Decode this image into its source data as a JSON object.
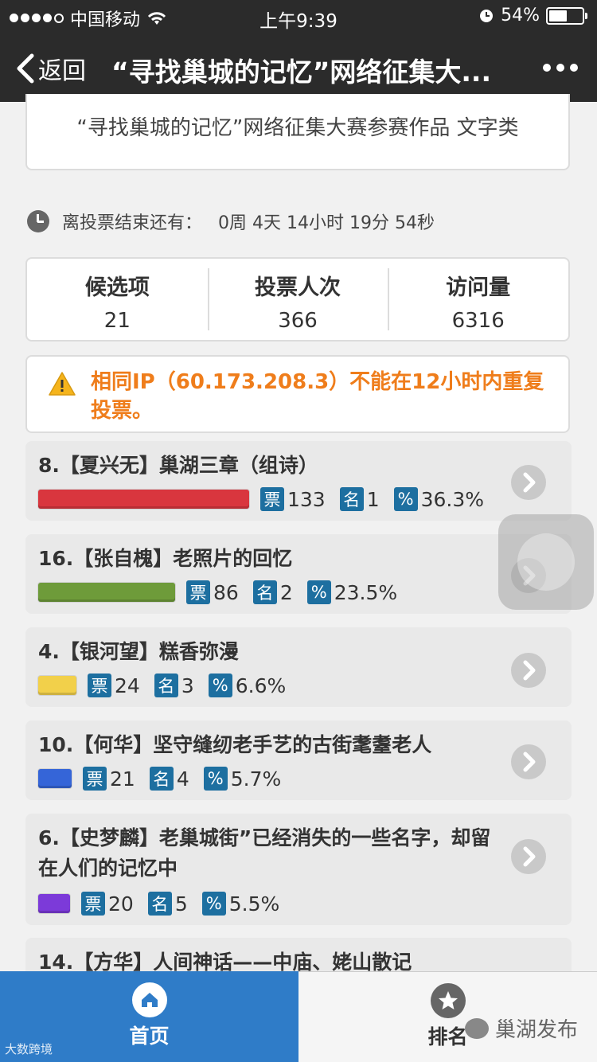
{
  "status_bar": {
    "carrier": "中国移动",
    "time": "上午9:39",
    "battery": "54%",
    "battery_level": 0.54
  },
  "nav": {
    "back_label": "返回",
    "title": "“寻找巢城的记忆”网络征集大..."
  },
  "header": {
    "subtitle": "“寻找巢城的记忆”网络征集大赛参赛作品 文字类"
  },
  "countdown": {
    "label": "离投票结束还有：",
    "value": "0周 4天 14小时 19分 54秒"
  },
  "stats": [
    {
      "label": "候选项",
      "value": "21"
    },
    {
      "label": "投票人次",
      "value": "366"
    },
    {
      "label": "访问量",
      "value": "6316"
    }
  ],
  "notice": {
    "text": "相同IP（60.173.208.3）不能在12小时内重复投票。"
  },
  "tags": {
    "votes": "票",
    "rank": "名",
    "percent": "%"
  },
  "items": [
    {
      "title": "8.【夏兴无】巢湖三章（组诗）",
      "votes": "133",
      "rank": "1",
      "percent": "36.3%",
      "share": 0.363,
      "color": "#d9363e"
    },
    {
      "title": "16.【张自槐】老照片的回忆",
      "votes": "86",
      "rank": "2",
      "percent": "23.5%",
      "share": 0.235,
      "color": "#6e9b3a"
    },
    {
      "title": "4.【银河望】糕香弥漫",
      "votes": "24",
      "rank": "3",
      "percent": "6.6%",
      "share": 0.066,
      "color": "#f2d04a"
    },
    {
      "title": "10.【何华】坚守缝纫老手艺的古街耄耋老人",
      "votes": "21",
      "rank": "4",
      "percent": "5.7%",
      "share": 0.057,
      "color": "#3565d8"
    },
    {
      "title": "6.【史梦麟】老巢城街”已经消失的一些名字，却留在人们的记忆中",
      "votes": "20",
      "rank": "5",
      "percent": "5.5%",
      "share": 0.055,
      "color": "#7c3ad9"
    },
    {
      "title": "14.【方华】人间神话——中庙、姥山散记"
    }
  ],
  "tabbar": {
    "home": "首页",
    "rank": "排名"
  },
  "watermarks": {
    "left": "大数跨境",
    "right": "巢湖发布"
  }
}
